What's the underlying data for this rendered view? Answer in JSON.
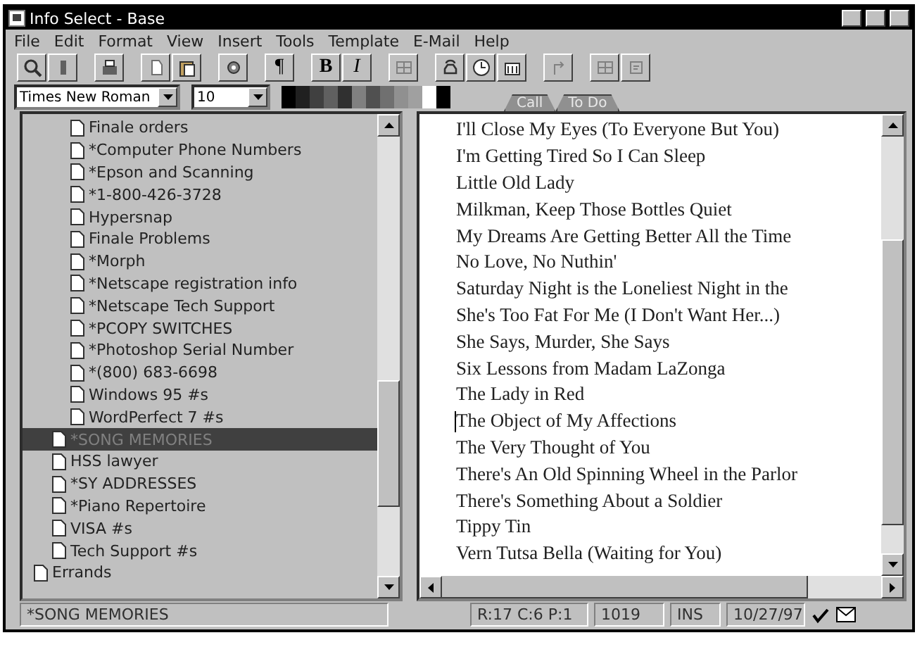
{
  "window": {
    "title": "Info Select - Base"
  },
  "menu": [
    "File",
    "Edit",
    "Format",
    "View",
    "Insert",
    "Tools",
    "Template",
    "E-Mail",
    "Help"
  ],
  "toolbar": [
    {
      "kind": "icon"
    },
    {
      "kind": "icon"
    },
    {
      "kind": "gap"
    },
    {
      "kind": "icon"
    },
    {
      "kind": "gap"
    },
    {
      "kind": "icon"
    },
    {
      "kind": "icon"
    },
    {
      "kind": "gap"
    },
    {
      "kind": "icon"
    },
    {
      "kind": "gap"
    },
    {
      "kind": "text",
      "text": "¶"
    },
    {
      "kind": "gap"
    },
    {
      "kind": "bold",
      "text": "B"
    },
    {
      "kind": "italic",
      "text": "I"
    },
    {
      "kind": "gap"
    },
    {
      "kind": "icon"
    },
    {
      "kind": "gap"
    },
    {
      "kind": "icon"
    },
    {
      "kind": "icon"
    },
    {
      "kind": "icon"
    },
    {
      "kind": "gap"
    },
    {
      "kind": "icon"
    },
    {
      "kind": "gap"
    },
    {
      "kind": "icon"
    },
    {
      "kind": "icon"
    }
  ],
  "font_bar": {
    "font": "Times New Roman",
    "size": "10"
  },
  "tabs": [
    {
      "label": "Call",
      "selected": false
    },
    {
      "label": "To Do",
      "selected": false
    }
  ],
  "tree": [
    {
      "children": [
        {
          "children": [
            {
              "label": "Finale orders",
              "selected": false
            },
            {
              "label": "*Computer Phone Numbers",
              "selected": false
            },
            {
              "label": "*Epson and Scanning",
              "selected": false
            },
            {
              "label": "*1-800-426-3728",
              "selected": false
            },
            {
              "label": "Hypersnap",
              "selected": false
            },
            {
              "label": "Finale Problems",
              "selected": false
            },
            {
              "label": "*Morph",
              "selected": false
            },
            {
              "label": "*Netscape registration info",
              "selected": false
            },
            {
              "label": "*Netscape Tech Support",
              "selected": false
            },
            {
              "label": "*PCOPY SWITCHES",
              "selected": false
            },
            {
              "label": "*Photoshop Serial Number",
              "selected": false
            },
            {
              "label": "*(800) 683-6698",
              "selected": false
            },
            {
              "label": "Windows 95 #s",
              "selected": false
            },
            {
              "label": "WordPerfect 7 #s",
              "selected": false
            }
          ]
        },
        {
          "label": "*SONG MEMORIES",
          "selected": true
        },
        {
          "label": "HSS lawyer",
          "selected": false
        },
        {
          "label": "*SY ADDRESSES",
          "selected": false
        },
        {
          "label": "*Piano Repertoire",
          "selected": false
        },
        {
          "label": "VISA #s",
          "selected": false
        },
        {
          "label": "Tech Support #s",
          "selected": false
        }
      ]
    },
    {
      "label": "Errands",
      "selected": false
    }
  ],
  "note_lines": [
    {
      "text": "I'll Close My Eyes (To Everyone But You)",
      "caret": false
    },
    {
      "text": "I'm Getting Tired So I Can Sleep",
      "caret": false
    },
    {
      "text": "Little Old Lady",
      "caret": false
    },
    {
      "text": "Milkman, Keep Those Bottles Quiet",
      "caret": false
    },
    {
      "text": "My Dreams Are Getting Better All the Time",
      "caret": false
    },
    {
      "text": "No Love, No Nuthin'",
      "caret": false
    },
    {
      "text": "Saturday Night is the Loneliest Night in the",
      "caret": false
    },
    {
      "text": "She's Too Fat For Me (I Don't Want Her...)",
      "caret": false
    },
    {
      "text": "She Says, Murder, She Says",
      "caret": false
    },
    {
      "text": "Six Lessons from Madam LaZonga",
      "caret": false
    },
    {
      "text": "The Lady in Red",
      "caret": false
    },
    {
      "text": "The Object of My Affections",
      "caret": true
    },
    {
      "text": "The Very Thought of You",
      "caret": false
    },
    {
      "text": "There's An Old Spinning Wheel in the Parlor",
      "caret": false
    },
    {
      "text": "There's Something About a Soldier",
      "caret": false
    },
    {
      "text": "Tippy Tin",
      "caret": false
    },
    {
      "text": "Vern Tutsa Bella (Waiting for You)",
      "caret": false
    }
  ],
  "status_bar": {
    "note": "*SONG MEMORIES",
    "position": "R:17 C:6 P:1",
    "count": "1019",
    "mode": "INS",
    "date": "10/27/97"
  }
}
